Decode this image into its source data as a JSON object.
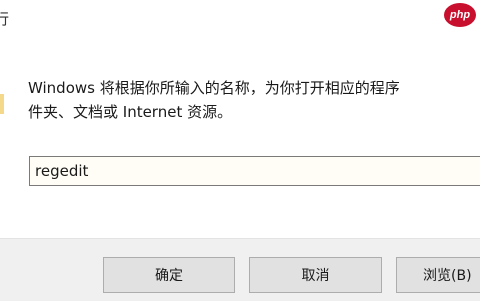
{
  "window": {
    "title": "行"
  },
  "watermark": {
    "text": "php"
  },
  "dialog": {
    "description_line1": "Windows 将根据你所输入的名称，为你打开相应的程序",
    "description_line2": "件夹、文档或 Internet 资源。",
    "open_label": "):",
    "open_value": "regedit"
  },
  "buttons": {
    "ok": "确定",
    "cancel": "取消",
    "browse": "浏览(B)"
  }
}
